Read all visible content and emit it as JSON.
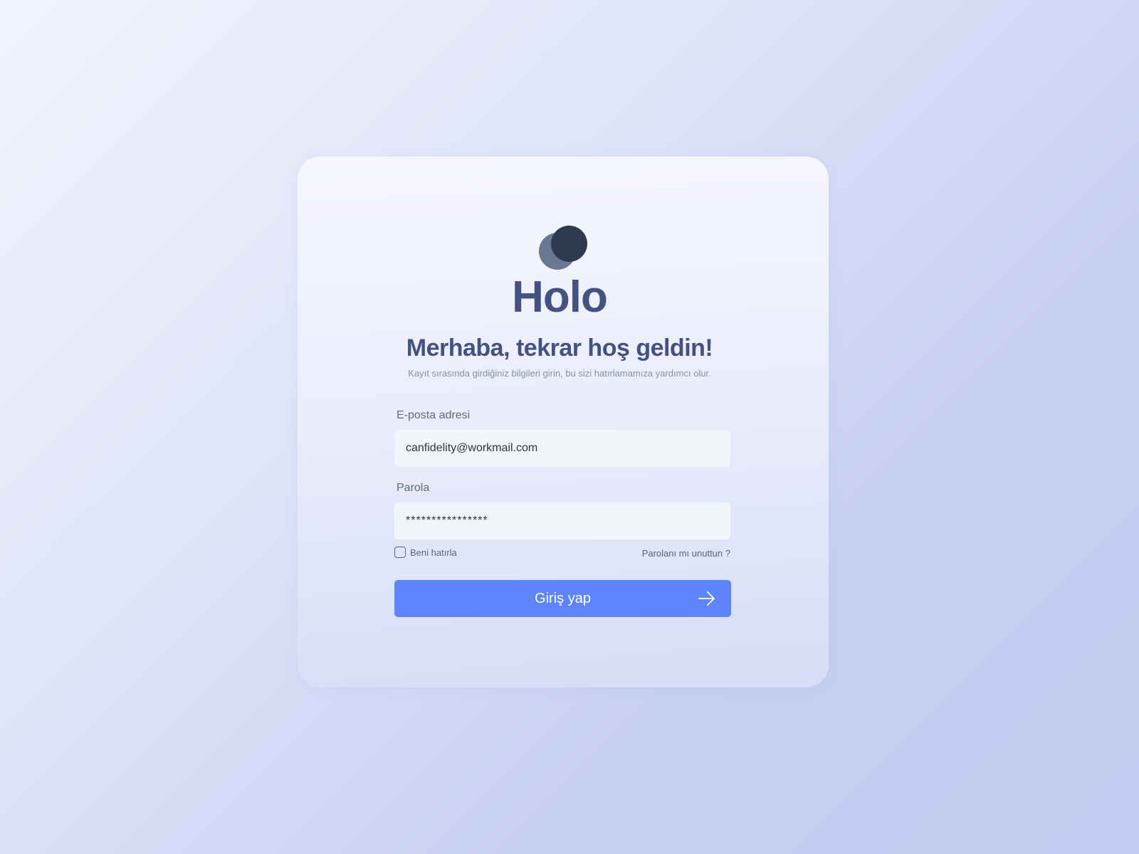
{
  "brand": {
    "name": "Holo",
    "logo_icon": "overlapping-circles-icon"
  },
  "heading": {
    "title": "Merhaba, tekrar hoş geldin!",
    "subtitle": "Kayıt sırasında girdiğiniz bilgileri girin, bu sizi hatırlamamıza yardımcı olur."
  },
  "form": {
    "email": {
      "label": "E-posta adresi",
      "value": "canfidelity@workmail.com"
    },
    "password": {
      "label": "Parola",
      "value": "****************"
    },
    "remember": {
      "label": "Beni hatırla",
      "checked": false
    },
    "forgot_label": "Parolanı mı unuttun ?",
    "submit_label": "Giriş yap",
    "submit_icon": "arrow-right-icon"
  },
  "colors": {
    "brand_text": "#445283",
    "primary_button": "#5c85ff",
    "logo_light": "#687893",
    "logo_dark": "#2e3a4e"
  }
}
